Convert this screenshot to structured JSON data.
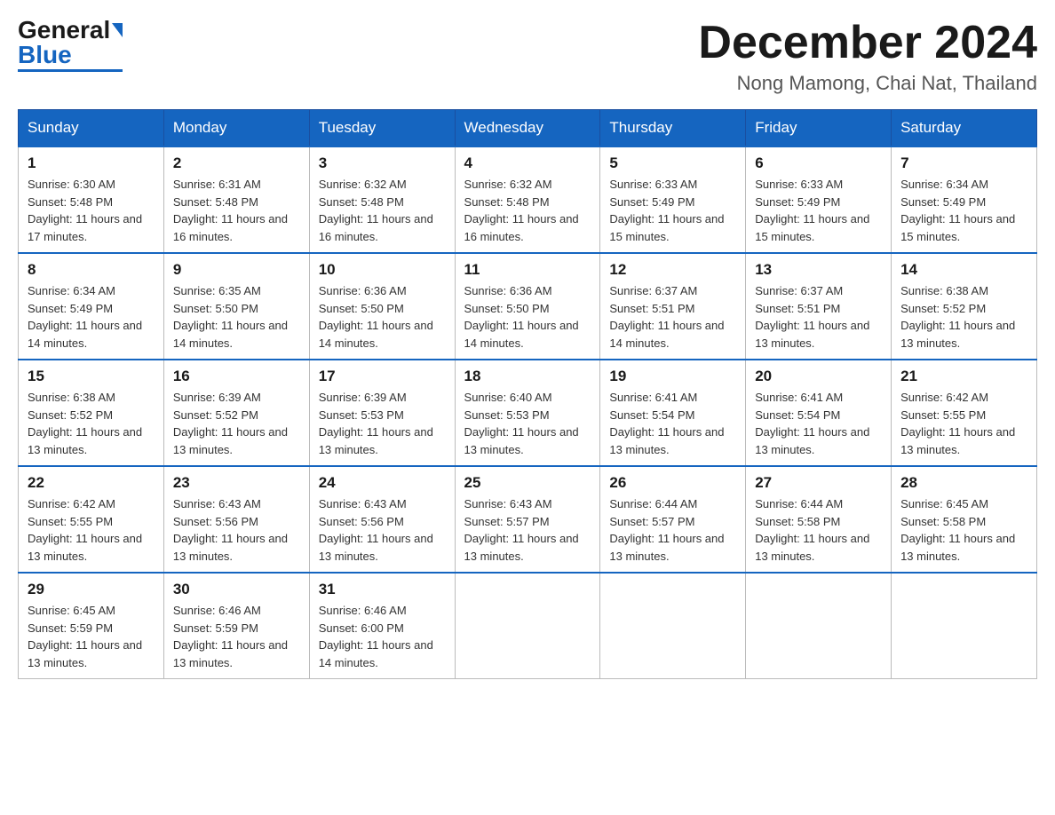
{
  "logo": {
    "general": "General",
    "blue": "Blue"
  },
  "title": {
    "month": "December 2024",
    "location": "Nong Mamong, Chai Nat, Thailand"
  },
  "weekdays": [
    "Sunday",
    "Monday",
    "Tuesday",
    "Wednesday",
    "Thursday",
    "Friday",
    "Saturday"
  ],
  "weeks": [
    [
      {
        "day": "1",
        "sunrise": "6:30 AM",
        "sunset": "5:48 PM",
        "daylight": "11 hours and 17 minutes."
      },
      {
        "day": "2",
        "sunrise": "6:31 AM",
        "sunset": "5:48 PM",
        "daylight": "11 hours and 16 minutes."
      },
      {
        "day": "3",
        "sunrise": "6:32 AM",
        "sunset": "5:48 PM",
        "daylight": "11 hours and 16 minutes."
      },
      {
        "day": "4",
        "sunrise": "6:32 AM",
        "sunset": "5:48 PM",
        "daylight": "11 hours and 16 minutes."
      },
      {
        "day": "5",
        "sunrise": "6:33 AM",
        "sunset": "5:49 PM",
        "daylight": "11 hours and 15 minutes."
      },
      {
        "day": "6",
        "sunrise": "6:33 AM",
        "sunset": "5:49 PM",
        "daylight": "11 hours and 15 minutes."
      },
      {
        "day": "7",
        "sunrise": "6:34 AM",
        "sunset": "5:49 PM",
        "daylight": "11 hours and 15 minutes."
      }
    ],
    [
      {
        "day": "8",
        "sunrise": "6:34 AM",
        "sunset": "5:49 PM",
        "daylight": "11 hours and 14 minutes."
      },
      {
        "day": "9",
        "sunrise": "6:35 AM",
        "sunset": "5:50 PM",
        "daylight": "11 hours and 14 minutes."
      },
      {
        "day": "10",
        "sunrise": "6:36 AM",
        "sunset": "5:50 PM",
        "daylight": "11 hours and 14 minutes."
      },
      {
        "day": "11",
        "sunrise": "6:36 AM",
        "sunset": "5:50 PM",
        "daylight": "11 hours and 14 minutes."
      },
      {
        "day": "12",
        "sunrise": "6:37 AM",
        "sunset": "5:51 PM",
        "daylight": "11 hours and 14 minutes."
      },
      {
        "day": "13",
        "sunrise": "6:37 AM",
        "sunset": "5:51 PM",
        "daylight": "11 hours and 13 minutes."
      },
      {
        "day": "14",
        "sunrise": "6:38 AM",
        "sunset": "5:52 PM",
        "daylight": "11 hours and 13 minutes."
      }
    ],
    [
      {
        "day": "15",
        "sunrise": "6:38 AM",
        "sunset": "5:52 PM",
        "daylight": "11 hours and 13 minutes."
      },
      {
        "day": "16",
        "sunrise": "6:39 AM",
        "sunset": "5:52 PM",
        "daylight": "11 hours and 13 minutes."
      },
      {
        "day": "17",
        "sunrise": "6:39 AM",
        "sunset": "5:53 PM",
        "daylight": "11 hours and 13 minutes."
      },
      {
        "day": "18",
        "sunrise": "6:40 AM",
        "sunset": "5:53 PM",
        "daylight": "11 hours and 13 minutes."
      },
      {
        "day": "19",
        "sunrise": "6:41 AM",
        "sunset": "5:54 PM",
        "daylight": "11 hours and 13 minutes."
      },
      {
        "day": "20",
        "sunrise": "6:41 AM",
        "sunset": "5:54 PM",
        "daylight": "11 hours and 13 minutes."
      },
      {
        "day": "21",
        "sunrise": "6:42 AM",
        "sunset": "5:55 PM",
        "daylight": "11 hours and 13 minutes."
      }
    ],
    [
      {
        "day": "22",
        "sunrise": "6:42 AM",
        "sunset": "5:55 PM",
        "daylight": "11 hours and 13 minutes."
      },
      {
        "day": "23",
        "sunrise": "6:43 AM",
        "sunset": "5:56 PM",
        "daylight": "11 hours and 13 minutes."
      },
      {
        "day": "24",
        "sunrise": "6:43 AM",
        "sunset": "5:56 PM",
        "daylight": "11 hours and 13 minutes."
      },
      {
        "day": "25",
        "sunrise": "6:43 AM",
        "sunset": "5:57 PM",
        "daylight": "11 hours and 13 minutes."
      },
      {
        "day": "26",
        "sunrise": "6:44 AM",
        "sunset": "5:57 PM",
        "daylight": "11 hours and 13 minutes."
      },
      {
        "day": "27",
        "sunrise": "6:44 AM",
        "sunset": "5:58 PM",
        "daylight": "11 hours and 13 minutes."
      },
      {
        "day": "28",
        "sunrise": "6:45 AM",
        "sunset": "5:58 PM",
        "daylight": "11 hours and 13 minutes."
      }
    ],
    [
      {
        "day": "29",
        "sunrise": "6:45 AM",
        "sunset": "5:59 PM",
        "daylight": "11 hours and 13 minutes."
      },
      {
        "day": "30",
        "sunrise": "6:46 AM",
        "sunset": "5:59 PM",
        "daylight": "11 hours and 13 minutes."
      },
      {
        "day": "31",
        "sunrise": "6:46 AM",
        "sunset": "6:00 PM",
        "daylight": "11 hours and 14 minutes."
      },
      null,
      null,
      null,
      null
    ]
  ]
}
